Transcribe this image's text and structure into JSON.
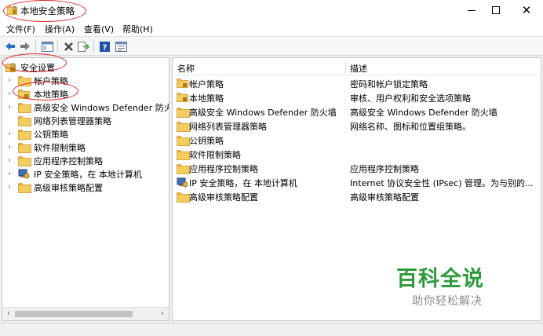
{
  "window": {
    "title": "本地安全策略",
    "close_glyph": "✕"
  },
  "menu": [
    "文件(F)",
    "操作(A)",
    "查看(V)",
    "帮助(H)"
  ],
  "toolbar": {
    "icons": [
      "back-icon",
      "forward-icon",
      "show-hide-tree-icon",
      "delete-icon",
      "export-list-icon",
      "help-icon",
      "properties-icon"
    ],
    "help_glyph": "?"
  },
  "tree": {
    "root": "安全设置",
    "items": [
      {
        "label": "帐户策略",
        "icon": "folder-icon"
      },
      {
        "label": "本地策略",
        "icon": "lock-folder-icon"
      },
      {
        "label": "高级安全 Windows Defender 防火墙",
        "icon": "folder-icon"
      },
      {
        "label": "网络列表管理器策略",
        "icon": "folder-icon"
      },
      {
        "label": "公钥策略",
        "icon": "folder-icon"
      },
      {
        "label": "软件限制策略",
        "icon": "folder-icon"
      },
      {
        "label": "应用程序控制策略",
        "icon": "folder-icon"
      },
      {
        "label": "IP 安全策略，在 本地计算机",
        "icon": "ip-security-icon"
      },
      {
        "label": "高级审核策略配置",
        "icon": "folder-icon"
      }
    ],
    "chevron": "›",
    "scroll_left": "‹",
    "scroll_right": "›"
  },
  "list": {
    "col_name": "名称",
    "col_desc": "描述",
    "rows": [
      {
        "name": "帐户策略",
        "desc": "密码和帐户锁定策略",
        "icon": "lock-folder-icon"
      },
      {
        "name": "本地策略",
        "desc": "审核、用户权利和安全选项策略",
        "icon": "lock-folder-icon"
      },
      {
        "name": "高级安全 Windows Defender 防火墙",
        "desc": "高级安全 Windows Defender 防火墙",
        "icon": "folder-icon"
      },
      {
        "name": "网络列表管理器策略",
        "desc": "网络名称、图标和位置组策略。",
        "icon": "folder-icon"
      },
      {
        "name": "公钥策略",
        "desc": "",
        "icon": "folder-icon"
      },
      {
        "name": "软件限制策略",
        "desc": "",
        "icon": "folder-icon"
      },
      {
        "name": "应用程序控制策略",
        "desc": "应用程序控制策略",
        "icon": "folder-icon"
      },
      {
        "name": "IP 安全策略，在 本地计算机",
        "desc": "Internet 协议安全性 (IPsec) 管理。为与别的...",
        "icon": "ip-security-icon"
      },
      {
        "name": "高级审核策略配置",
        "desc": "高级审核策略配置",
        "icon": "folder-icon"
      }
    ]
  },
  "watermark": {
    "brand": "百科全说",
    "slogan": "助你轻松解决"
  },
  "colors": {
    "annotation": "#e0232b",
    "watermark_green": "#2e9a3c"
  }
}
